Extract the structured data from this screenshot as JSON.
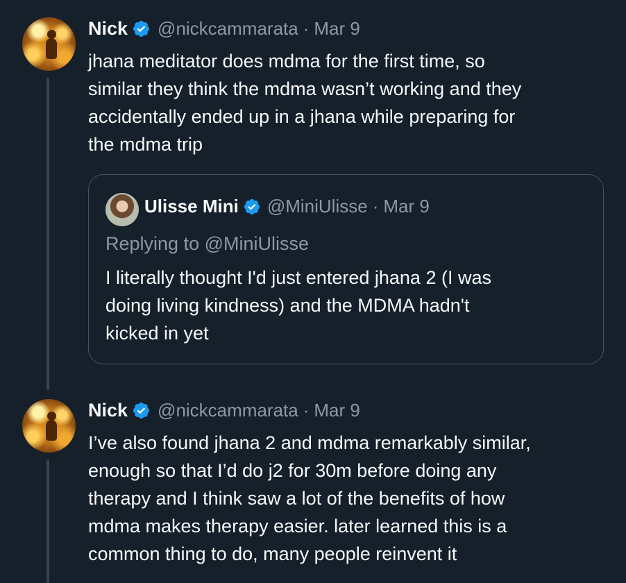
{
  "colors": {
    "background": "#15202b",
    "text_primary": "#f7f9f9",
    "text_secondary": "#8b98a5",
    "verified": "#1d9bf0",
    "border": "#425364"
  },
  "tweets": [
    {
      "author_name": "Nick",
      "handle": "@nickcammarata",
      "separator": "·",
      "date": "Mar 9",
      "text": "jhana meditator does mdma for the first time, so\nsimilar they think the mdma wasn’t working and they\naccidentally ended up in a jhana while preparing for\nthe mdma trip",
      "avatar_icon": "avatar-image",
      "quote": {
        "author_name": "Ulisse Mini",
        "handle": "@MiniUlisse",
        "separator": "·",
        "date": "Mar 9",
        "replying_to": "Replying to @MiniUlisse",
        "text": "I literally thought I'd just entered jhana 2 (I was\ndoing living kindness) and the MDMA hadn't\nkicked in yet"
      }
    },
    {
      "author_name": "Nick",
      "handle": "@nickcammarata",
      "separator": "·",
      "date": "Mar 9",
      "text": "I’ve also found jhana 2 and mdma remarkably similar,\nenough so that I’d do j2 for 30m before doing any\ntherapy and I think saw a lot of the benefits of how\nmdma makes therapy easier. later learned this is a\ncommon thing to do, many people reinvent it",
      "avatar_icon": "avatar-image"
    }
  ]
}
